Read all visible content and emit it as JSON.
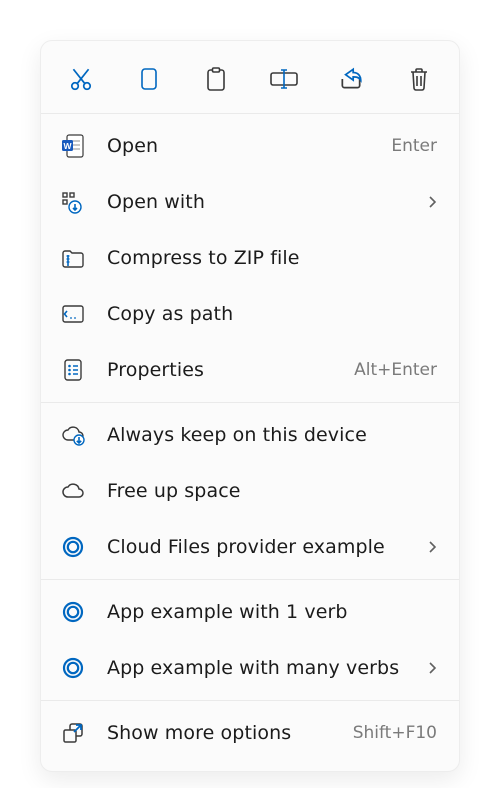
{
  "toolbar": {
    "cut": {
      "name": "cut",
      "color": "#0067c0"
    },
    "copy": {
      "name": "copy",
      "color": "#0067c0"
    },
    "paste": {
      "name": "paste",
      "color": "#3a3a3a"
    },
    "rename": {
      "name": "rename",
      "color": "#0067c0"
    },
    "share": {
      "name": "share",
      "color": "#0067c0"
    },
    "delete": {
      "name": "delete",
      "color": "#3a3a3a"
    }
  },
  "groups": [
    {
      "items": [
        {
          "icon": "word-doc-icon",
          "label": "Open",
          "accel": "Enter",
          "submenu": false
        },
        {
          "icon": "open-with-icon",
          "label": "Open with",
          "accel": "",
          "submenu": true
        },
        {
          "icon": "zip-icon",
          "label": "Compress to ZIP file",
          "accel": "",
          "submenu": false
        },
        {
          "icon": "copy-path-icon",
          "label": "Copy as path",
          "accel": "",
          "submenu": false
        },
        {
          "icon": "properties-icon",
          "label": "Properties",
          "accel": "Alt+Enter",
          "submenu": false
        }
      ]
    },
    {
      "items": [
        {
          "icon": "cloud-keep-icon",
          "label": "Always keep on this device",
          "accel": "",
          "submenu": false
        },
        {
          "icon": "cloud-free-icon",
          "label": "Free up space",
          "accel": "",
          "submenu": false
        },
        {
          "icon": "cloud-provider-icon",
          "label": "Cloud Files provider example",
          "accel": "",
          "submenu": true
        }
      ]
    },
    {
      "items": [
        {
          "icon": "app-verb-icon",
          "label": "App example with 1 verb",
          "accel": "",
          "submenu": false
        },
        {
          "icon": "app-verb-icon",
          "label": "App example with many verbs",
          "accel": "",
          "submenu": true
        }
      ]
    },
    {
      "items": [
        {
          "icon": "more-options-icon",
          "label": "Show more options",
          "accel": "Shift+F10",
          "submenu": false
        }
      ]
    }
  ],
  "colors": {
    "accent": "#0067c0",
    "ink": "#3a3a3a",
    "muted": "#7a7a7a"
  }
}
